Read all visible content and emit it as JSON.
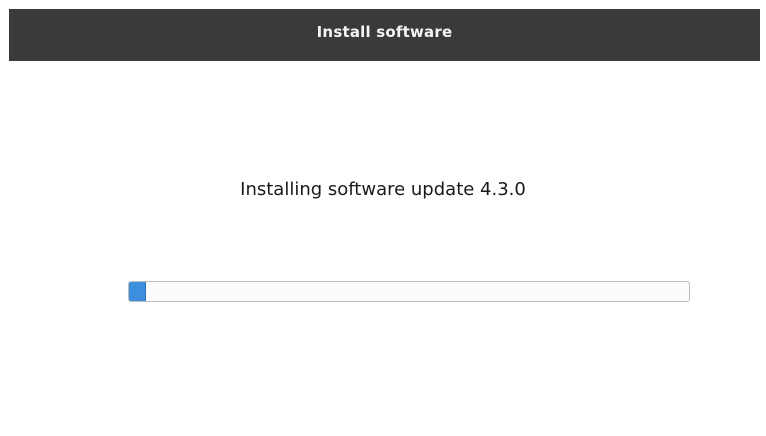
{
  "window": {
    "title": "Install software"
  },
  "install": {
    "status_text": "Installing software update 4.3.0",
    "progress_fraction": 0.03
  },
  "colors": {
    "titlebar_bg": "#3a3a3a",
    "titlebar_text": "#f4f4f4",
    "progress_fill": "#3c8fdd",
    "progress_border": "#bdbdbd"
  }
}
